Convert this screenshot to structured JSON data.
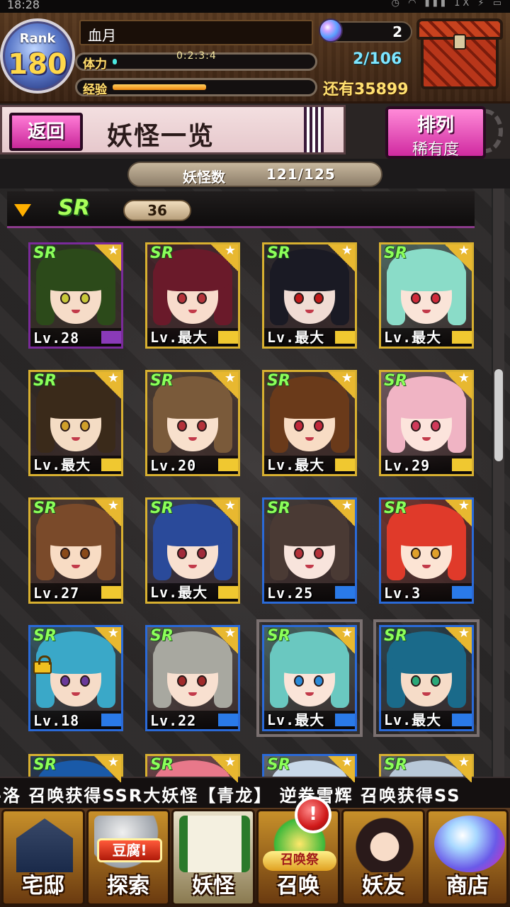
{
  "status_bar": {
    "time": "18:28",
    "icons": "◷ ◠ ▮▮▮ 1X ⚡ ▭"
  },
  "player": {
    "rank_label": "Rank",
    "rank": "180",
    "name": "血月",
    "stamina_label": "体力",
    "stamina_timer": "0:2:3:4",
    "stamina_fill": 0.02,
    "exp_label": "经验",
    "exp_fill": 0.48,
    "gems": "2",
    "capacity": "2/106",
    "remaining": "还有35899"
  },
  "title_bar": {
    "back_label": "返回",
    "title": "妖怪一览",
    "sort_line1": "排列",
    "sort_line2": "稀有度"
  },
  "count_pill": {
    "label": "妖怪数",
    "value": "121/125"
  },
  "section": {
    "rarity": "SR",
    "count": "36"
  },
  "scroll_fraction": 0.36,
  "cards": [
    {
      "rarity": "SR",
      "level": "Lv.28",
      "frame": "purple",
      "hair": "#2c4a1a",
      "eyes": "#c8c83a",
      "skin": "#f6dcc8"
    },
    {
      "rarity": "SR",
      "level": "Lv.最大",
      "frame": "gold",
      "hair": "#6a1a2a",
      "eyes": "#b4323a",
      "skin": "#f8dccc"
    },
    {
      "rarity": "SR",
      "level": "Lv.最大",
      "frame": "gold",
      "hair": "#1a1a24",
      "eyes": "#c01a1a",
      "skin": "#f0dcd4"
    },
    {
      "rarity": "SR",
      "level": "Lv.最大",
      "frame": "gold",
      "hair": "#8adcc8",
      "eyes": "#d02a3a",
      "skin": "#fae4d8"
    },
    {
      "rarity": "SR",
      "level": "Lv.最大",
      "frame": "gold",
      "hair": "#3a2a1a",
      "eyes": "#d0a02a",
      "skin": "#f4dcc4"
    },
    {
      "rarity": "SR",
      "level": "Lv.20",
      "frame": "gold",
      "hair": "#7a5a3a",
      "eyes": "#b4323a",
      "skin": "#f8e0cc"
    },
    {
      "rarity": "SR",
      "level": "Lv.最大",
      "frame": "gold",
      "hair": "#6a3a1a",
      "eyes": "#c0283a",
      "skin": "#f8dcc4"
    },
    {
      "rarity": "SR",
      "level": "Lv.29",
      "frame": "gold",
      "hair": "#f0b4c4",
      "eyes": "#d03a5a",
      "skin": "#fce4dc"
    },
    {
      "rarity": "SR",
      "level": "Lv.27",
      "frame": "gold",
      "hair": "#7a4a2a",
      "eyes": "#8a4a1a",
      "skin": "#f8dcc4"
    },
    {
      "rarity": "SR",
      "level": "Lv.最大",
      "frame": "gold",
      "hair": "#2a4a9a",
      "eyes": "#a02a3a",
      "skin": "#f8e0d0"
    },
    {
      "rarity": "SR",
      "level": "Lv.25",
      "frame": "blue",
      "hair": "#4a3a34",
      "eyes": "#b4323a",
      "skin": "#f8e4dc"
    },
    {
      "rarity": "SR",
      "level": "Lv.3",
      "frame": "blue",
      "hair": "#e03a2a",
      "eyes": "#e0a02a",
      "skin": "#fce4d4"
    },
    {
      "rarity": "SR",
      "level": "Lv.18",
      "frame": "blue",
      "hair": "#3aa8c8",
      "eyes": "#6a3a9a",
      "skin": "#f6dcc8",
      "locked": true
    },
    {
      "rarity": "SR",
      "level": "Lv.22",
      "frame": "blue",
      "hair": "#a8a8a0",
      "eyes": "#a02a2a",
      "skin": "#f8e0d0"
    },
    {
      "rarity": "SR",
      "level": "Lv.最大",
      "frame": "blue",
      "hair": "#6ac8c0",
      "eyes": "#2a8ad8",
      "skin": "#fae4d8",
      "selected": true
    },
    {
      "rarity": "SR",
      "level": "Lv.最大",
      "frame": "blue",
      "hair": "#1a6a8a",
      "eyes": "#2aa878",
      "skin": "#f6dcc8",
      "selected": true
    },
    {
      "rarity": "SR",
      "level": "",
      "frame": "gold",
      "hair": "#1a5aa8",
      "eyes": "#2a2a2a",
      "skin": "#f6dcc8"
    },
    {
      "rarity": "SR",
      "level": "",
      "frame": "gold",
      "hair": "#e8788a",
      "eyes": "#2a2a2a",
      "skin": "#f6dcc8"
    },
    {
      "rarity": "SR",
      "level": "",
      "frame": "blue",
      "hair": "#c8d8e8",
      "eyes": "#2a2a2a",
      "skin": "#f6dcc8"
    },
    {
      "rarity": "SR",
      "level": "",
      "frame": "gold",
      "hair": "#b8c8d8",
      "eyes": "#2a2a2a",
      "skin": "#f6dcc8"
    }
  ],
  "ticker": "-洛 召唤获得SSR大妖怪【青龙】  逆卷雪辉 召唤获得SS",
  "nav": {
    "home": "宅邸",
    "explore": "探索",
    "explore_tag": "豆腐!",
    "yokai": "妖怪",
    "summon": "召唤",
    "summon_tag": "召唤祭",
    "friends": "妖友",
    "shop": "商店",
    "alert": "!"
  }
}
